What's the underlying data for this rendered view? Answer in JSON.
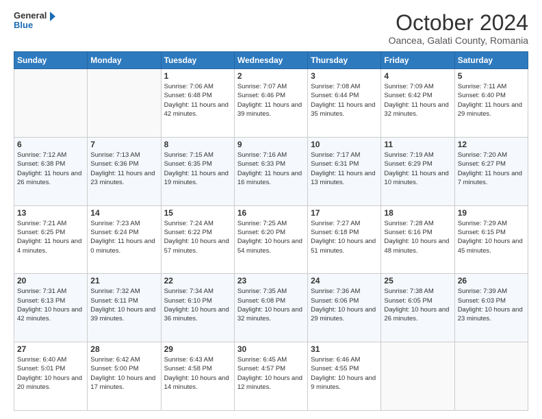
{
  "logo": {
    "general": "General",
    "blue": "Blue"
  },
  "header": {
    "month": "October 2024",
    "location": "Oancea, Galati County, Romania"
  },
  "weekdays": [
    "Sunday",
    "Monday",
    "Tuesday",
    "Wednesday",
    "Thursday",
    "Friday",
    "Saturday"
  ],
  "weeks": [
    [
      {
        "day": "",
        "detail": ""
      },
      {
        "day": "",
        "detail": ""
      },
      {
        "day": "1",
        "detail": "Sunrise: 7:06 AM\nSunset: 6:48 PM\nDaylight: 11 hours and 42 minutes."
      },
      {
        "day": "2",
        "detail": "Sunrise: 7:07 AM\nSunset: 6:46 PM\nDaylight: 11 hours and 39 minutes."
      },
      {
        "day": "3",
        "detail": "Sunrise: 7:08 AM\nSunset: 6:44 PM\nDaylight: 11 hours and 35 minutes."
      },
      {
        "day": "4",
        "detail": "Sunrise: 7:09 AM\nSunset: 6:42 PM\nDaylight: 11 hours and 32 minutes."
      },
      {
        "day": "5",
        "detail": "Sunrise: 7:11 AM\nSunset: 6:40 PM\nDaylight: 11 hours and 29 minutes."
      }
    ],
    [
      {
        "day": "6",
        "detail": "Sunrise: 7:12 AM\nSunset: 6:38 PM\nDaylight: 11 hours and 26 minutes."
      },
      {
        "day": "7",
        "detail": "Sunrise: 7:13 AM\nSunset: 6:36 PM\nDaylight: 11 hours and 23 minutes."
      },
      {
        "day": "8",
        "detail": "Sunrise: 7:15 AM\nSunset: 6:35 PM\nDaylight: 11 hours and 19 minutes."
      },
      {
        "day": "9",
        "detail": "Sunrise: 7:16 AM\nSunset: 6:33 PM\nDaylight: 11 hours and 16 minutes."
      },
      {
        "day": "10",
        "detail": "Sunrise: 7:17 AM\nSunset: 6:31 PM\nDaylight: 11 hours and 13 minutes."
      },
      {
        "day": "11",
        "detail": "Sunrise: 7:19 AM\nSunset: 6:29 PM\nDaylight: 11 hours and 10 minutes."
      },
      {
        "day": "12",
        "detail": "Sunrise: 7:20 AM\nSunset: 6:27 PM\nDaylight: 11 hours and 7 minutes."
      }
    ],
    [
      {
        "day": "13",
        "detail": "Sunrise: 7:21 AM\nSunset: 6:25 PM\nDaylight: 11 hours and 4 minutes."
      },
      {
        "day": "14",
        "detail": "Sunrise: 7:23 AM\nSunset: 6:24 PM\nDaylight: 11 hours and 0 minutes."
      },
      {
        "day": "15",
        "detail": "Sunrise: 7:24 AM\nSunset: 6:22 PM\nDaylight: 10 hours and 57 minutes."
      },
      {
        "day": "16",
        "detail": "Sunrise: 7:25 AM\nSunset: 6:20 PM\nDaylight: 10 hours and 54 minutes."
      },
      {
        "day": "17",
        "detail": "Sunrise: 7:27 AM\nSunset: 6:18 PM\nDaylight: 10 hours and 51 minutes."
      },
      {
        "day": "18",
        "detail": "Sunrise: 7:28 AM\nSunset: 6:16 PM\nDaylight: 10 hours and 48 minutes."
      },
      {
        "day": "19",
        "detail": "Sunrise: 7:29 AM\nSunset: 6:15 PM\nDaylight: 10 hours and 45 minutes."
      }
    ],
    [
      {
        "day": "20",
        "detail": "Sunrise: 7:31 AM\nSunset: 6:13 PM\nDaylight: 10 hours and 42 minutes."
      },
      {
        "day": "21",
        "detail": "Sunrise: 7:32 AM\nSunset: 6:11 PM\nDaylight: 10 hours and 39 minutes."
      },
      {
        "day": "22",
        "detail": "Sunrise: 7:34 AM\nSunset: 6:10 PM\nDaylight: 10 hours and 36 minutes."
      },
      {
        "day": "23",
        "detail": "Sunrise: 7:35 AM\nSunset: 6:08 PM\nDaylight: 10 hours and 32 minutes."
      },
      {
        "day": "24",
        "detail": "Sunrise: 7:36 AM\nSunset: 6:06 PM\nDaylight: 10 hours and 29 minutes."
      },
      {
        "day": "25",
        "detail": "Sunrise: 7:38 AM\nSunset: 6:05 PM\nDaylight: 10 hours and 26 minutes."
      },
      {
        "day": "26",
        "detail": "Sunrise: 7:39 AM\nSunset: 6:03 PM\nDaylight: 10 hours and 23 minutes."
      }
    ],
    [
      {
        "day": "27",
        "detail": "Sunrise: 6:40 AM\nSunset: 5:01 PM\nDaylight: 10 hours and 20 minutes."
      },
      {
        "day": "28",
        "detail": "Sunrise: 6:42 AM\nSunset: 5:00 PM\nDaylight: 10 hours and 17 minutes."
      },
      {
        "day": "29",
        "detail": "Sunrise: 6:43 AM\nSunset: 4:58 PM\nDaylight: 10 hours and 14 minutes."
      },
      {
        "day": "30",
        "detail": "Sunrise: 6:45 AM\nSunset: 4:57 PM\nDaylight: 10 hours and 12 minutes."
      },
      {
        "day": "31",
        "detail": "Sunrise: 6:46 AM\nSunset: 4:55 PM\nDaylight: 10 hours and 9 minutes."
      },
      {
        "day": "",
        "detail": ""
      },
      {
        "day": "",
        "detail": ""
      }
    ]
  ]
}
